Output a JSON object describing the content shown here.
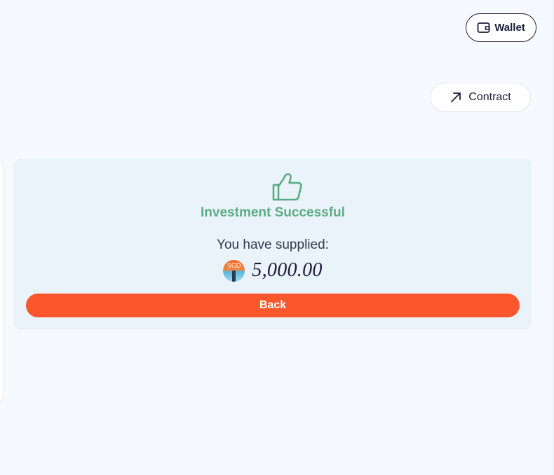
{
  "header": {
    "wallet_label": "Wallet",
    "wallet_icon": "wallet-icon",
    "contract_label": "Contract",
    "contract_icon": "arrow-up-right-icon"
  },
  "result_card": {
    "icon": "thumbs-up-icon",
    "title": "Investment Successful",
    "supplied_label": "You have supplied:",
    "token_icon": "sgd-token-icon",
    "token_symbol": "SGD",
    "amount": "5,000.00",
    "back_label": "Back"
  },
  "colors": {
    "background": "#f6fafe",
    "card_background": "#eaf3fa",
    "success_green": "#5cac83",
    "primary_button": "#fc572c",
    "text_dark": "#1c1a3a"
  }
}
